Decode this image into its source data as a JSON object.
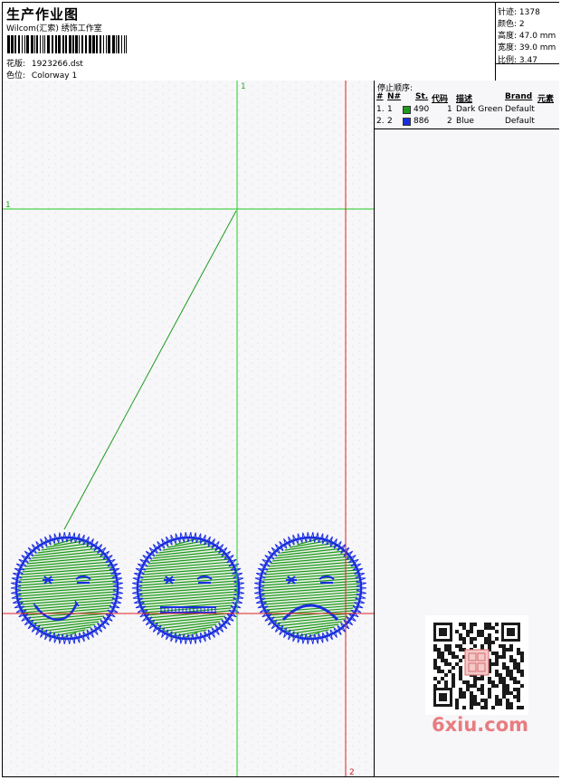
{
  "header": {
    "title": "生产作业图",
    "company": "Wilcom(汇索) 绣饰工作室",
    "design_label": "花版:",
    "design_value": "1923266.dst",
    "colorway_label": "色位:",
    "colorway_value": "Colorway 1"
  },
  "stats": {
    "stitches": "针迹: 1378",
    "colors": "颜色: 2",
    "height": "高度: 47.0 mm",
    "width": "宽度: 39.0 mm",
    "ratio": "比例: 3.47"
  },
  "stop_sequence": {
    "title": "停止顺序:",
    "headers": [
      "#",
      "N#",
      "St.",
      "代码",
      "描述",
      "Brand",
      "元素"
    ],
    "rows": [
      {
        "idx": "1.",
        "n": "1",
        "code_num": "490",
        "code": "1",
        "desc": "Dark Green",
        "brand": "Default",
        "color": "#1e9a1e"
      },
      {
        "idx": "2.",
        "n": "2",
        "code_num": "886",
        "code": "2",
        "desc": "Blue",
        "brand": "Default",
        "color": "#1a2ee0"
      }
    ]
  },
  "canvas": {
    "guide_labels": [
      "1",
      "1",
      "2"
    ],
    "thread_colors": {
      "green": "#1e9a1e",
      "blue": "#1a2ee0",
      "guide_green": "#22cc22",
      "guide_red": "#dd2222"
    }
  },
  "watermark": "6xiu.com",
  "icons": {
    "qr": "qr-code-icon",
    "barcode": "barcode-icon",
    "seal": "seal-stamp-icon"
  }
}
